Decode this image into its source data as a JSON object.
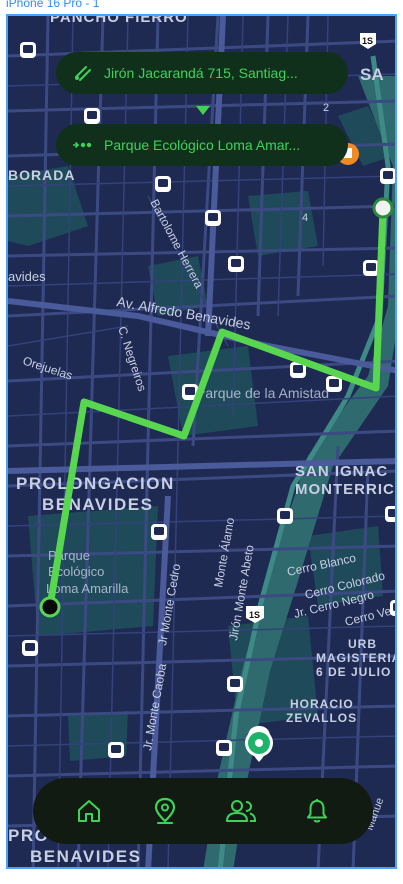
{
  "frame": {
    "label": "iPhone 16 Pro - 1"
  },
  "route": {
    "origin": "Jirón Jacarandá 715, Santiag...",
    "destination": "Parque Ecológico Loma Amar...",
    "origin_icon": "route-start-icon",
    "destination_icon": "route-end-icon"
  },
  "map": {
    "labels": {
      "pancho_fierro": "PANCHO FIERRO",
      "sa": "SA",
      "borada": "BORADA",
      "avidas": "avides",
      "bartolome": "Bartolome Herrera",
      "alfredo": "Av. Alfredo Benavides",
      "negreiros": "C. Negreiros",
      "orejuelas": "Orejuelas",
      "amistad": "Parque de la Amistad",
      "prolongacion1": "PROLONGACION",
      "prolongacion2": "BENAVIDES",
      "parque_eco1": "Parque",
      "parque_eco2": "Ecológico",
      "parque_eco3": "Loma Amarilla",
      "san_ignacio1": "SAN IGNAC",
      "san_ignacio2": "MONTERRICO-",
      "alamo": "Monte Álamo",
      "abeto": "Jirón Monte Abeto",
      "cedro": "Jr Monte Cedro",
      "caoba": "Jr. Monte Caoba",
      "cerro_blanco": "Cerro Blanco",
      "cerro_colorado": "Cerro Colorado",
      "cerro_negro": "Jr. Cerro Negro",
      "cerro_verde": "Cerro Ver",
      "urb1": "URB",
      "urb2": "MAGISTERIAL",
      "urb3": "6 DE JULIO",
      "horacio1": "HORACIO",
      "horacio2": "ZEVALLOS",
      "pro_bottom1": "PRO",
      "pro_bottom2": "BENAVIDES",
      "manue": "Manue",
      "hw_1s_top": "1S",
      "hw_1s_mid": "1S",
      "num_2": "2",
      "num_4": "4"
    }
  },
  "nav": {
    "items": [
      {
        "name": "home",
        "icon": "home-icon"
      },
      {
        "name": "location",
        "icon": "location-pin-icon",
        "active": true
      },
      {
        "name": "people",
        "icon": "people-icon"
      },
      {
        "name": "notifications",
        "icon": "bell-icon"
      }
    ]
  },
  "colors": {
    "map_bg": "#1f2a52",
    "route": "#58d64f",
    "pill_bg": "#10301c",
    "accent": "#3fd25a",
    "nav_bg": "#121b12"
  }
}
